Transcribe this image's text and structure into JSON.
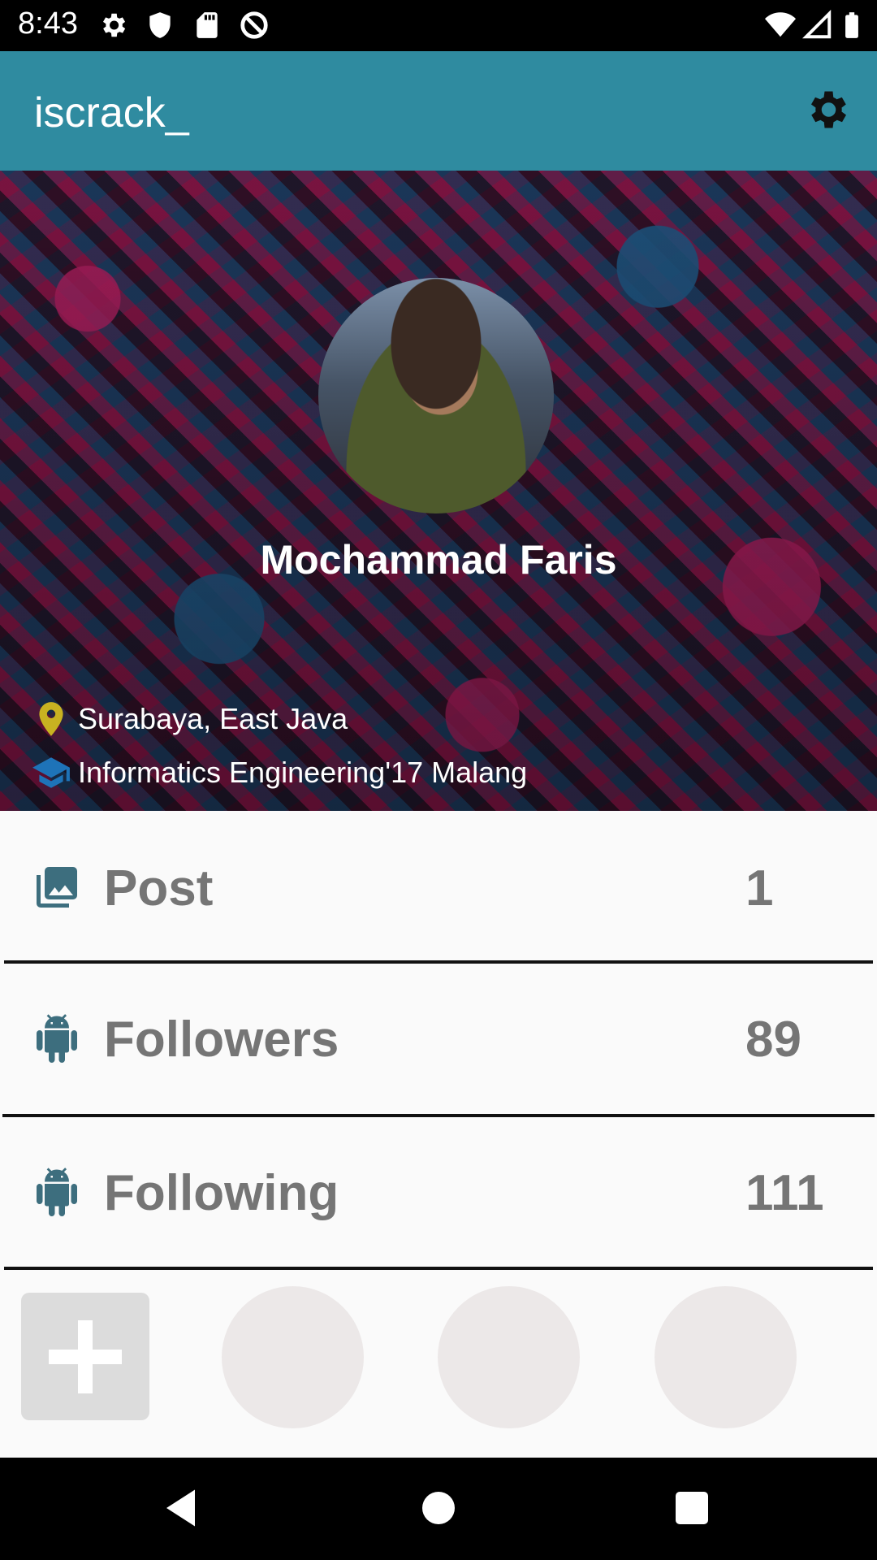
{
  "status_bar": {
    "time": "8:43",
    "icons": [
      "gear-icon",
      "shield-icon",
      "sd-card-icon",
      "no-sync-icon",
      "wifi-icon",
      "signal-icon",
      "battery-icon"
    ]
  },
  "app_bar": {
    "title": "iscrack_",
    "settings_icon": "gear-icon"
  },
  "profile": {
    "name": "Mochammad Faris",
    "location": "Surabaya, East Java",
    "education": "Informatics Engineering'17 Malang",
    "location_icon_color": "#c8b221",
    "education_icon_color": "#1e73b8"
  },
  "stats": [
    {
      "label": "Post",
      "value": "1",
      "icon": "gallery-icon"
    },
    {
      "label": "Followers",
      "value": "89",
      "icon": "android-icon"
    },
    {
      "label": "Following",
      "value": "111",
      "icon": "android-icon"
    }
  ],
  "colors": {
    "app_bar": "#2f8ba0",
    "stat_text": "#757575",
    "stat_icon": "#3d6e7e"
  },
  "nav": {
    "icons": [
      "back-icon",
      "home-icon",
      "recents-icon"
    ]
  }
}
